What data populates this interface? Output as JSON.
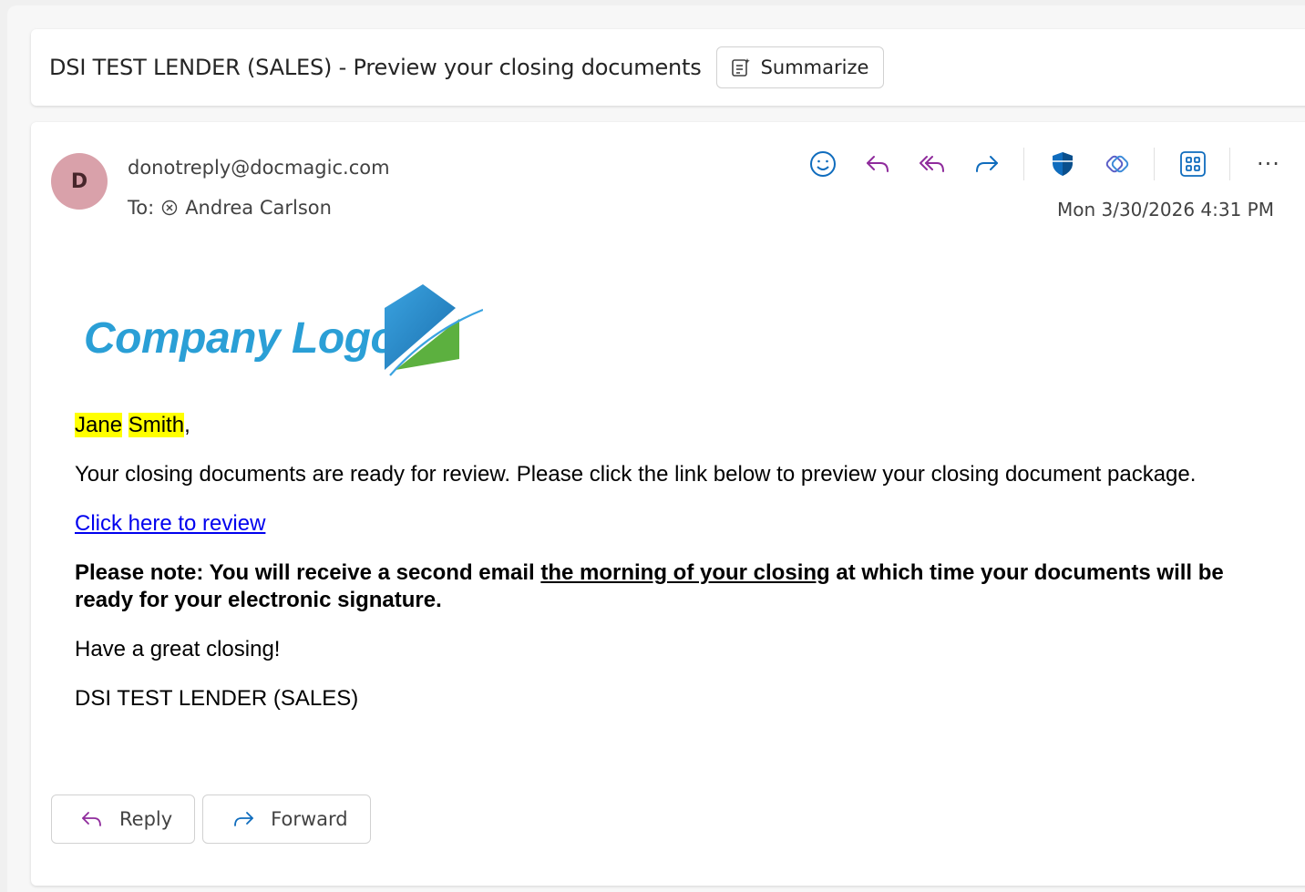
{
  "subject": {
    "title": "DSI TEST LENDER (SALES) - Preview your closing documents",
    "summarize_label": "Summarize"
  },
  "message": {
    "avatar_initial": "D",
    "sender": "donotreply@docmagic.com",
    "to_label": "To:",
    "recipient": "Andrea Carlson",
    "timestamp": "Mon 3/30/2026 4:31 PM"
  },
  "toolbar": {
    "icons": [
      "smiley-icon",
      "reply-icon",
      "reply-all-icon",
      "forward-icon",
      "shield-icon",
      "loop-icon",
      "apps-icon",
      "more-icon"
    ],
    "more_label": "···"
  },
  "body": {
    "logo_text": "Company Logo",
    "greeting_first": "Jane",
    "greeting_last": "Smith",
    "greeting_punct": ",",
    "intro": "Your closing documents are ready for review. Please click the link below to preview your closing document package.",
    "link_text": "Click here to review",
    "note_prefix": "Please note: You will receive a second email ",
    "note_underlined": "the morning of your closing",
    "note_suffix": " at which time your documents will be ready for your electronic signature.",
    "closing_line": "Have a great closing!",
    "signature": "DSI TEST LENDER (SALES)"
  },
  "actions": {
    "reply_label": "Reply",
    "forward_label": "Forward"
  },
  "colors": {
    "accent_blue": "#0f6cbd",
    "reply_purple": "#8f2b9c",
    "avatar_bg": "#d9a1aa",
    "highlight": "#ffff00",
    "logo_blue": "#2a9fd6",
    "logo_green": "#5cb03f"
  }
}
